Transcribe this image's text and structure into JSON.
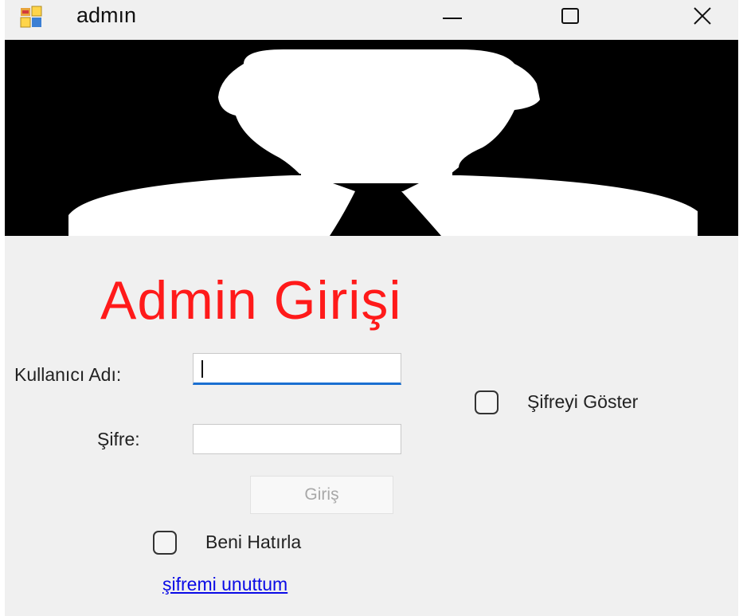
{
  "window": {
    "title": "admın",
    "controls": [
      "minimize-icon",
      "maximize-icon",
      "close-icon"
    ]
  },
  "banner": {
    "icon": "user-silhouette-image"
  },
  "form": {
    "heading": "Admin Girişi",
    "heading_color": "#ff1a1a",
    "username_label": "Kullanıcı Adı:",
    "username_value": "",
    "password_label": "Şifre:",
    "password_value": "",
    "show_password_label": "Şifreyi Göster",
    "show_password_checked": false,
    "login_button": "Giriş",
    "login_button_enabled": false,
    "remember_me_label": "Beni Hatırla",
    "remember_me_checked": false,
    "forgot_link": "şifremi unuttum"
  }
}
